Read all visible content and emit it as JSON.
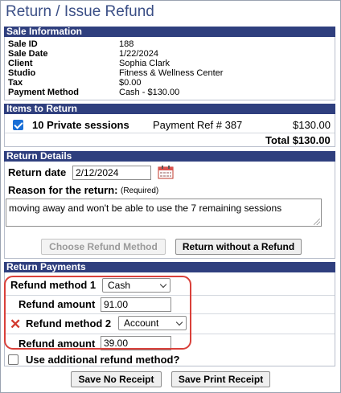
{
  "title": "Return / Issue Refund",
  "sale_info": {
    "header": "Sale Information",
    "rows": [
      {
        "label": "Sale ID",
        "value": "188"
      },
      {
        "label": "Sale Date",
        "value": "1/22/2024"
      },
      {
        "label": "Client",
        "value": "Sophia Clark"
      },
      {
        "label": "Studio",
        "value": "Fitness & Wellness Center"
      },
      {
        "label": "Tax",
        "value": "$0.00"
      },
      {
        "label": "Payment Method",
        "value": "Cash - $130.00"
      }
    ]
  },
  "items": {
    "header": "Items to Return",
    "rows": [
      {
        "checked": true,
        "name": "10 Private sessions",
        "ref": "Payment Ref # 387",
        "amount": "$130.00"
      }
    ],
    "total": "Total $130.00"
  },
  "return_details": {
    "header": "Return Details",
    "date_label": "Return date",
    "date_value": "2/12/2024",
    "reason_label": "Reason for the return:",
    "reason_required": "(Required)",
    "reason_value": "moving away and won't be able to use the 7 remaining sessions",
    "choose_button": "Choose Refund Method",
    "without_refund_button": "Return without a Refund"
  },
  "payments": {
    "header": "Return Payments",
    "methods": [
      {
        "method_label": "Refund method 1",
        "method_value": "Cash",
        "amount_label": "Refund amount",
        "amount_value": "91.00"
      },
      {
        "method_label": "Refund method 2",
        "method_value": "Account",
        "amount_label": "Refund amount",
        "amount_value": "39.00"
      }
    ],
    "additional_label": "Use additional refund method?",
    "additional_checked": false
  },
  "footer": {
    "save_no_receipt": "Save No Receipt",
    "save_print_receipt": "Save Print Receipt"
  },
  "colors": {
    "header_bg": "#2f3f7e",
    "title": "#3b4f86",
    "highlight": "#d9403a",
    "checkbox": "#1a6fd6"
  }
}
